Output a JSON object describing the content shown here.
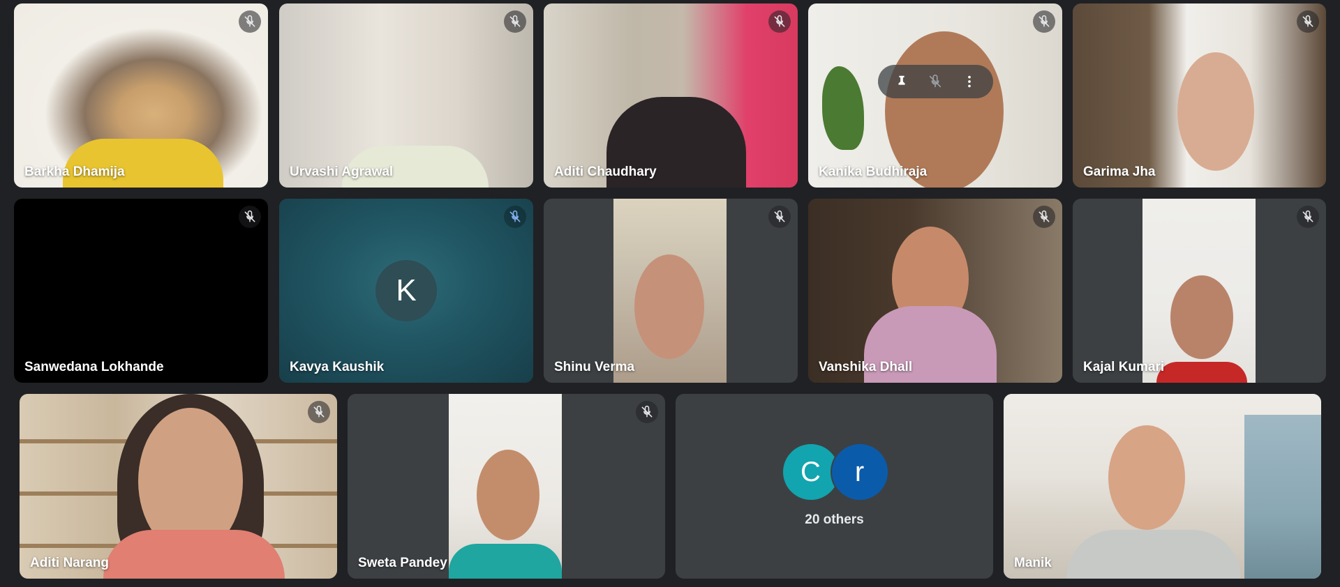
{
  "participants": [
    {
      "name": "Barkha Dhamija",
      "muted": true
    },
    {
      "name": "Urvashi Agrawal",
      "muted": true
    },
    {
      "name": "Aditi Chaudhary",
      "muted": true
    },
    {
      "name": "Kanika Budhiraja",
      "muted": true
    },
    {
      "name": "Garima Jha",
      "muted": true
    },
    {
      "name": "Sanwedana Lokhande",
      "muted": true
    },
    {
      "name": "Kavya Kaushik",
      "muted": true,
      "avatar_letter": "K"
    },
    {
      "name": "Shinu Verma",
      "muted": true
    },
    {
      "name": "Vanshika Dhall",
      "muted": true
    },
    {
      "name": "Kajal Kumari",
      "muted": true
    },
    {
      "name": "Aditi Narang",
      "muted": true
    },
    {
      "name": "Sweta Pandey",
      "muted": true
    },
    {
      "name": "Manik",
      "muted": false,
      "is_self": true
    }
  ],
  "others": {
    "avatars": [
      "C",
      "r"
    ],
    "label": "20 others"
  },
  "hover_controls": [
    "pin-icon",
    "mute-icon",
    "more-options-icon"
  ],
  "colors": {
    "background": "#202124",
    "tile": "#3c4043",
    "self_border": "#a8c7fa",
    "avatar_c": "#12a4af",
    "avatar_r": "#0b5bab",
    "kavya_bg": "#205562"
  }
}
